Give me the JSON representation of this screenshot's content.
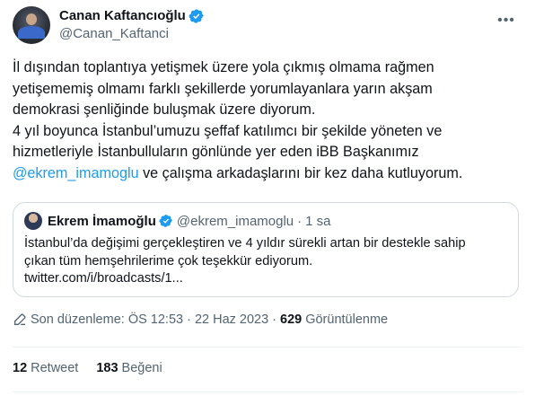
{
  "author": {
    "display_name": "Canan Kaftancıoğlu",
    "handle": "@Canan_Kaftanci"
  },
  "tweet": {
    "lines": [
      "İl dışından toplantıya yetişmek üzere yola çıkmış olmama rağmen",
      "yetişememiş olmamı farklı şekillerde yorumlayanlara yarın akşam",
      "demokrasi şenliğinde buluşmak üzere diyorum.",
      "4 yıl boyunca İstanbul’umuzu şeffaf katılımcı bir şekilde yöneten ve",
      "hizmetleriyle İstanbulluların gönlünde yer eden iBB Başkanımız"
    ],
    "mention": "@ekrem_imamoglu",
    "last_line_rest": " ve çalışma arkadaşlarını bir kez daha kutluyorum."
  },
  "quote": {
    "display_name": "Ekrem İmamoğlu",
    "handle": "@ekrem_imamoglu",
    "dot": "·",
    "time": "1 sa",
    "lines": [
      "İstanbul’da değişimi gerçekleştiren ve 4 yıldır sürekli artan bir destekle sahip",
      "çıkan tüm hemşehrilerime çok teşekkür ediyorum.",
      "twitter.com/i/broadcasts/1..."
    ]
  },
  "meta": {
    "edited_label": "Son düzenleme: ÖS 12:53",
    "sep1": "·",
    "date": "22 Haz 2023",
    "sep2": "·",
    "views_count": "629",
    "views_label": "Görüntülenme"
  },
  "stats": {
    "retweets_count": "12",
    "retweets_label": "Retweet",
    "likes_count": "183",
    "likes_label": "Beğeni"
  },
  "colors": {
    "accent": "#1d9bf0",
    "text": "#0f1419",
    "muted": "#536471",
    "border": "#cfd9de"
  },
  "icons": {
    "verified": "verified-badge-icon",
    "more": "more-options-icon",
    "edit": "pencil-icon"
  }
}
